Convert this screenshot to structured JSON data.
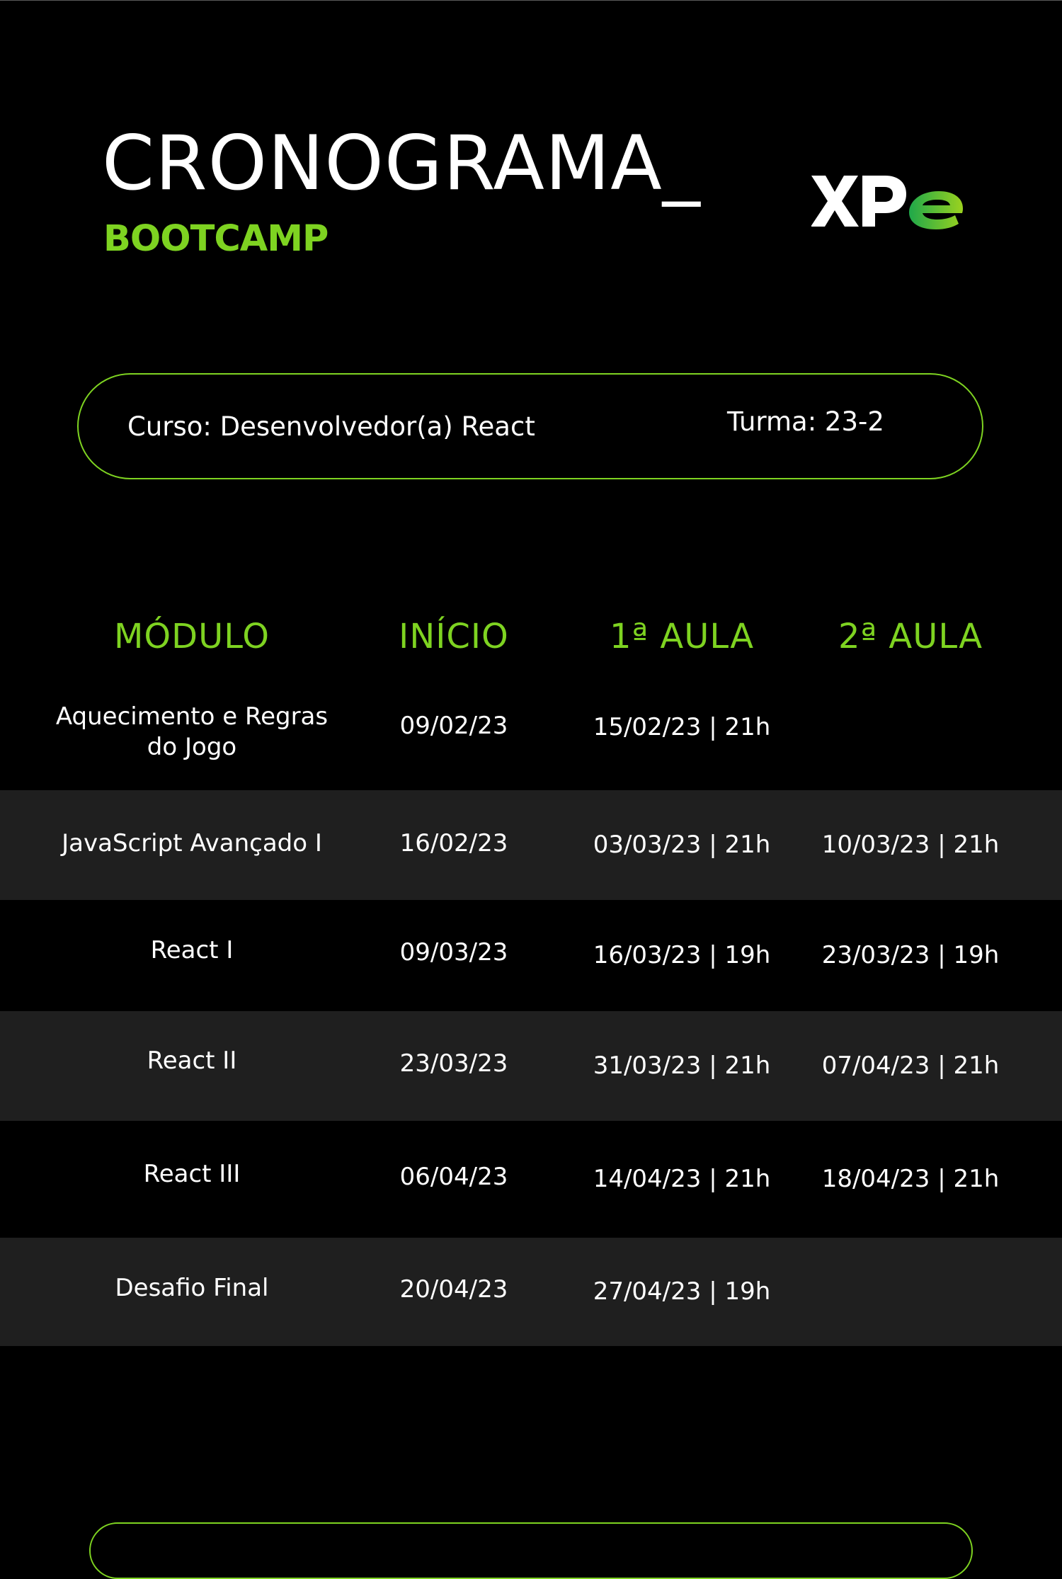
{
  "header": {
    "title": "CRONOGRAMA_",
    "subtitle": "BOOTCAMP",
    "logo_text": "XPe"
  },
  "course": {
    "course_label": "Curso: Desenvolvedor(a) React",
    "class_label": "Turma: 23-2"
  },
  "table": {
    "columns": [
      "MÓDULO",
      "INÍCIO",
      "1ª AULA",
      "2ª AULA"
    ],
    "rows": [
      {
        "module": "Aquecimento e Regras do Jogo",
        "start": "09/02/23",
        "class1": "15/02/23 | 21h",
        "class2": ""
      },
      {
        "module": "JavaScript Avançado I",
        "start": "16/02/23",
        "class1": "03/03/23 | 21h",
        "class2": "10/03/23 | 21h"
      },
      {
        "module": "React I",
        "start": "09/03/23",
        "class1": "16/03/23 | 19h",
        "class2": "23/03/23 | 19h"
      },
      {
        "module": "React II",
        "start": "23/03/23",
        "class1": "31/03/23 | 21h",
        "class2": "07/04/23 | 21h"
      },
      {
        "module": "React III",
        "start": "06/04/23",
        "class1": "14/04/23 | 21h",
        "class2": "18/04/23 | 21h"
      },
      {
        "module": "Desafio Final",
        "start": "20/04/23",
        "class1": "27/04/23 | 19h",
        "class2": ""
      }
    ]
  },
  "colors": {
    "background": "#000000",
    "accent_green": "#7ed321",
    "alt_row": "#1f1f1f",
    "text": "#ffffff"
  }
}
